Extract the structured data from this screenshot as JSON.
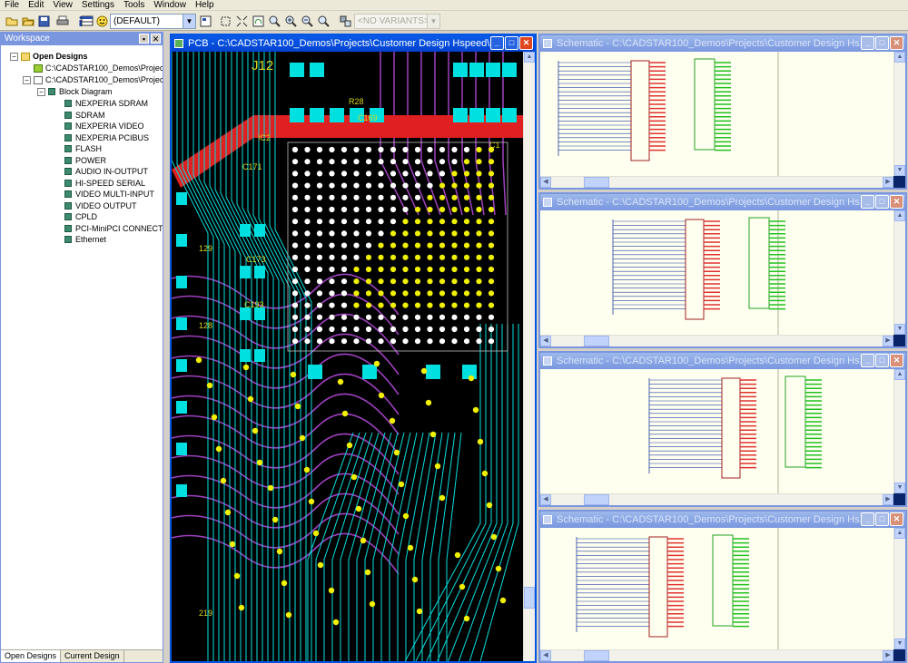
{
  "menu": [
    "File",
    "Edit",
    "View",
    "Settings",
    "Tools",
    "Window",
    "Help"
  ],
  "toolbar": {
    "config_combo": "(DEFAULT)",
    "variants_combo": "<NO VARIANTS>"
  },
  "workspace": {
    "title": "Workspace",
    "root": "Open Designs",
    "designs": [
      "C:\\CADSTAR100_Demos\\Projects",
      "C:\\CADSTAR100_Demos\\Projects"
    ],
    "block_diagram": "Block Diagram",
    "blocks": [
      "NEXPERIA SDRAM",
      "SDRAM",
      "NEXPERIA VIDEO",
      "NEXPERIA PCIBUS",
      "FLASH",
      "POWER",
      "AUDIO IN-OUTPUT",
      "HI-SPEED SERIAL",
      "VIDEO MULTI-INPUT",
      "VIDEO OUTPUT",
      "CPLD",
      "PCI-MiniPCI CONNECTOR",
      "Ethernet"
    ],
    "tabs": [
      "Open Designs",
      "Current Design"
    ]
  },
  "pcb_window": {
    "title": "PCB - C:\\CADSTAR100_Demos\\Projects\\Customer Design Hspeed\\...",
    "labels": [
      "J12",
      "R28",
      "C169",
      "C171",
      "IC2",
      "C173",
      "C193",
      "128",
      "219",
      "129",
      "C1"
    ]
  },
  "schematic_windows": [
    {
      "title": "Schematic - C:\\CADSTAR100_Demos\\Projects\\Customer Design Hs..."
    },
    {
      "title": "Schematic - C:\\CADSTAR100_Demos\\Projects\\Customer Design Hs..."
    },
    {
      "title": "Schematic - C:\\CADSTAR100_Demos\\Projects\\Customer Design Hs..."
    },
    {
      "title": "Schematic - C:\\CADSTAR100_Demos\\Projects\\Customer Design Hs..."
    }
  ],
  "colors": {
    "pcb_background": "#000000",
    "trace_cyan": "#00e0e0",
    "trace_purple": "#a040c0",
    "pad_yellow": "#f0f000",
    "pad_cyan": "#00e0e0",
    "schematic_background": "#fffff0",
    "title_active": "#0a5ae8",
    "title_inactive": "#7a96df"
  }
}
